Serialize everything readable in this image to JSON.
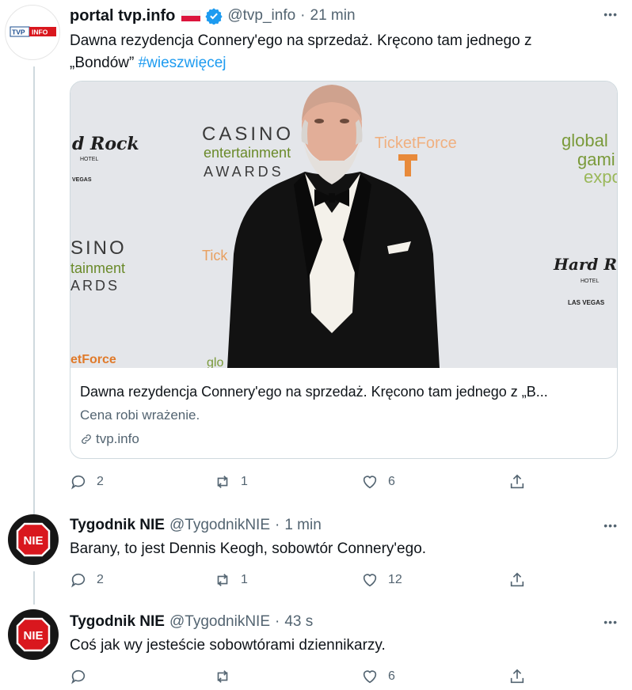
{
  "tweet1": {
    "name": "portal tvp.info",
    "handle": "@tvp_info",
    "time": "21 min",
    "avatar_text": "TVP INFO",
    "text_line1": "Dawna rezydencja Connery'ego na sprzedaż. Kręcono tam jednego z",
    "text_line2": "„Bondów”",
    "hashtag": "#wieszwięcej",
    "card": {
      "title": "Dawna rezydencja Connery'ego na sprzedaż. Kręcono tam jednego z „B...",
      "description": "Cena robi wrażenie.",
      "domain": "tvp.info",
      "backdrop": {
        "casino": "CASINO",
        "entertainment": "entertainment",
        "awards": "AWARDS",
        "hardrock_left": "d Rock",
        "hotel": "HOTEL",
        "vegas_left": "VEGAS",
        "ticketforce": "TicketForce",
        "global": "global",
        "gaming": "gami",
        "expo": "expo",
        "sino": "SINO",
        "tainment": "tainment",
        "ards": "ARDS",
        "tick": "Tick",
        "hardrock_right": "Hard Ro",
        "hotel_right": "HOTEL",
        "lasvegas": "LAS VEGAS",
        "etforce": "etForce",
        "glo": "glo"
      }
    },
    "replies": "2",
    "retweets": "1",
    "likes": "6"
  },
  "tweet2": {
    "name": "Tygodnik NIE",
    "handle": "@TygodnikNIE",
    "time": "1 min",
    "avatar_text": "NIE",
    "text": "Barany, to jest Dennis Keogh, sobowtór Connery'ego.",
    "replies": "2",
    "retweets": "1",
    "likes": "12"
  },
  "tweet3": {
    "name": "Tygodnik NIE",
    "handle": "@TygodnikNIE",
    "time": "43 s",
    "avatar_text": "NIE",
    "text": "Coś jak wy jesteście sobowtórami dziennikarzy.",
    "replies": "",
    "retweets": "",
    "likes": "6"
  },
  "separator": "·",
  "more_icon": "•••",
  "colors": {
    "link": "#1d9bf0",
    "verified": "#1d9bf0",
    "nie_red": "#d9171e",
    "secondary": "#536471"
  }
}
